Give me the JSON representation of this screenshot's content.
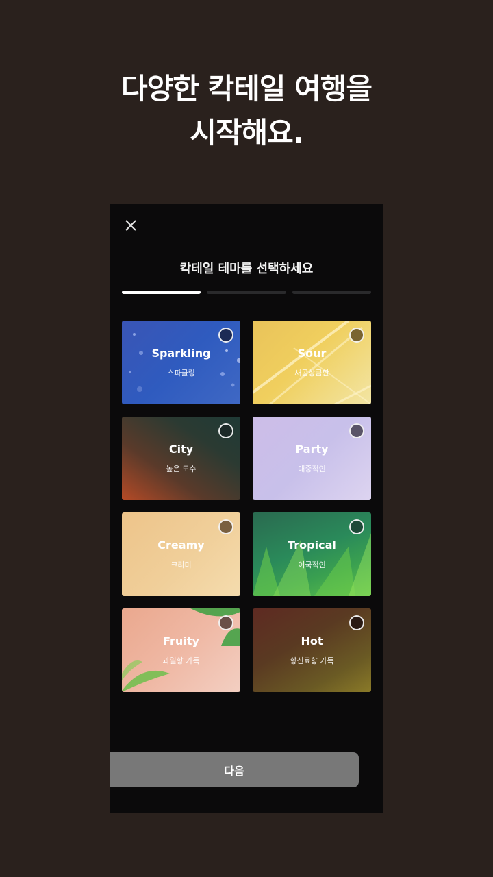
{
  "headline": {
    "line1": "다양한 칵테일 여행을",
    "line2": "시작해요."
  },
  "modal": {
    "title": "칵테일 테마를 선택하세요"
  },
  "progress": {
    "current_step": 1,
    "total_steps": 3
  },
  "themes": [
    {
      "name": "Sparkling",
      "sub": "스파클링",
      "selected": false
    },
    {
      "name": "Sour",
      "sub": "새콤상큼한",
      "selected": false
    },
    {
      "name": "City",
      "sub": "높은 도수",
      "selected": false
    },
    {
      "name": "Party",
      "sub": "대중적인",
      "selected": false
    },
    {
      "name": "Creamy",
      "sub": "크리미",
      "selected": false
    },
    {
      "name": "Tropical",
      "sub": "이국적인",
      "selected": false
    },
    {
      "name": "Fruity",
      "sub": "과일향 가득",
      "selected": false
    },
    {
      "name": "Hot",
      "sub": "향신료향 가득",
      "selected": false
    }
  ],
  "next_button": {
    "label": "다음"
  },
  "icons": {
    "close": "close-icon"
  },
  "colors": {
    "page_bg": "#2a211d",
    "panel_bg": "#0b0a0b",
    "button_bg": "#787878"
  }
}
